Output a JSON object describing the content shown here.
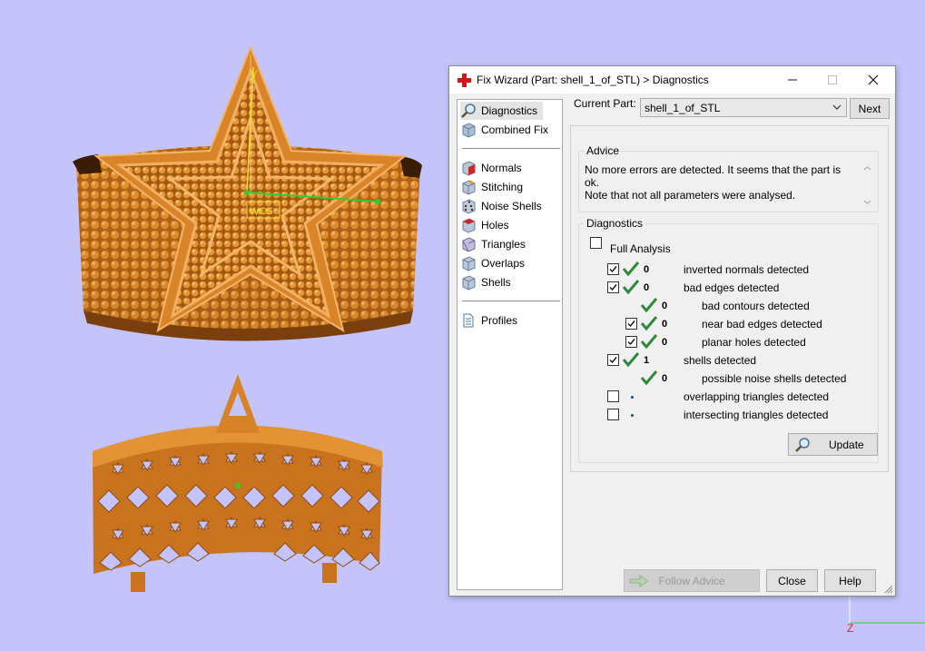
{
  "window": {
    "title": "Fix Wizard (Part: shell_1_of_STL) > Diagnostics",
    "minimize_icon": "minimize-icon",
    "maximize_icon": "maximize-icon",
    "close_icon": "close-icon"
  },
  "nav": {
    "top_items": [
      {
        "label": "Diagnostics",
        "icon": "magnifier-icon",
        "active": true
      },
      {
        "label": "Combined Fix",
        "icon": "cube-icon"
      }
    ],
    "fix_items": [
      {
        "label": "Normals",
        "icon": "red-cube-icon"
      },
      {
        "label": "Stitching",
        "icon": "stitch-cube-icon"
      },
      {
        "label": "Noise Shells",
        "icon": "dice-icon"
      },
      {
        "label": "Holes",
        "icon": "holes-cube-icon"
      },
      {
        "label": "Triangles",
        "icon": "triangles-cube-icon"
      },
      {
        "label": "Overlaps",
        "icon": "overlaps-cube-icon"
      },
      {
        "label": "Shells",
        "icon": "shells-cube-icon"
      }
    ],
    "bottom_items": [
      {
        "label": "Profiles",
        "icon": "document-icon"
      }
    ]
  },
  "part": {
    "label": "Current Part:",
    "value": "shell_1_of_STL",
    "next_label": "Next"
  },
  "advice": {
    "group_label": "Advice",
    "line1": "No more errors are detected. It seems that the part is ok.",
    "line2": "Note that not all parameters were analysed."
  },
  "diagnostics": {
    "group_label": "Diagnostics",
    "full_analysis_label": "Full Analysis",
    "full_analysis_checked": false,
    "rows": [
      {
        "checkbox": true,
        "checked": true,
        "status": "ok",
        "count": "0",
        "label": "inverted normals detected",
        "indent": 0
      },
      {
        "checkbox": true,
        "checked": true,
        "status": "ok",
        "count": "0",
        "label": "bad edges detected",
        "indent": 0
      },
      {
        "checkbox": false,
        "checked": false,
        "status": "ok",
        "count": "0",
        "label": "bad contours detected",
        "indent": 1
      },
      {
        "checkbox": true,
        "checked": true,
        "status": "ok",
        "count": "0",
        "label": "near bad edges detected",
        "indent": 1
      },
      {
        "checkbox": true,
        "checked": true,
        "status": "ok",
        "count": "0",
        "label": "planar holes detected",
        "indent": 1
      },
      {
        "checkbox": true,
        "checked": true,
        "status": "ok",
        "count": "1",
        "label": "shells detected",
        "indent": 0
      },
      {
        "checkbox": false,
        "checked": false,
        "status": "ok",
        "count": "0",
        "label": "possible noise shells detected",
        "indent": 1
      },
      {
        "checkbox": true,
        "checked": false,
        "status": "unknown",
        "count": "",
        "label": "overlapping triangles detected",
        "indent": 0
      },
      {
        "checkbox": true,
        "checked": false,
        "status": "unknown",
        "count": "",
        "label": "intersecting triangles detected",
        "indent": 0
      }
    ],
    "update_label": "Update",
    "update_icon": "magnifier-icon"
  },
  "buttons": {
    "follow_advice": "Follow Advice",
    "follow_icon": "arrow-right-icon",
    "close": "Close",
    "help": "Help"
  },
  "viewport": {
    "wcs_label": "WCS",
    "axis_y": "Y",
    "axis_z": "Z",
    "model_color": "#c8741f",
    "background": "#c4c4fb"
  }
}
